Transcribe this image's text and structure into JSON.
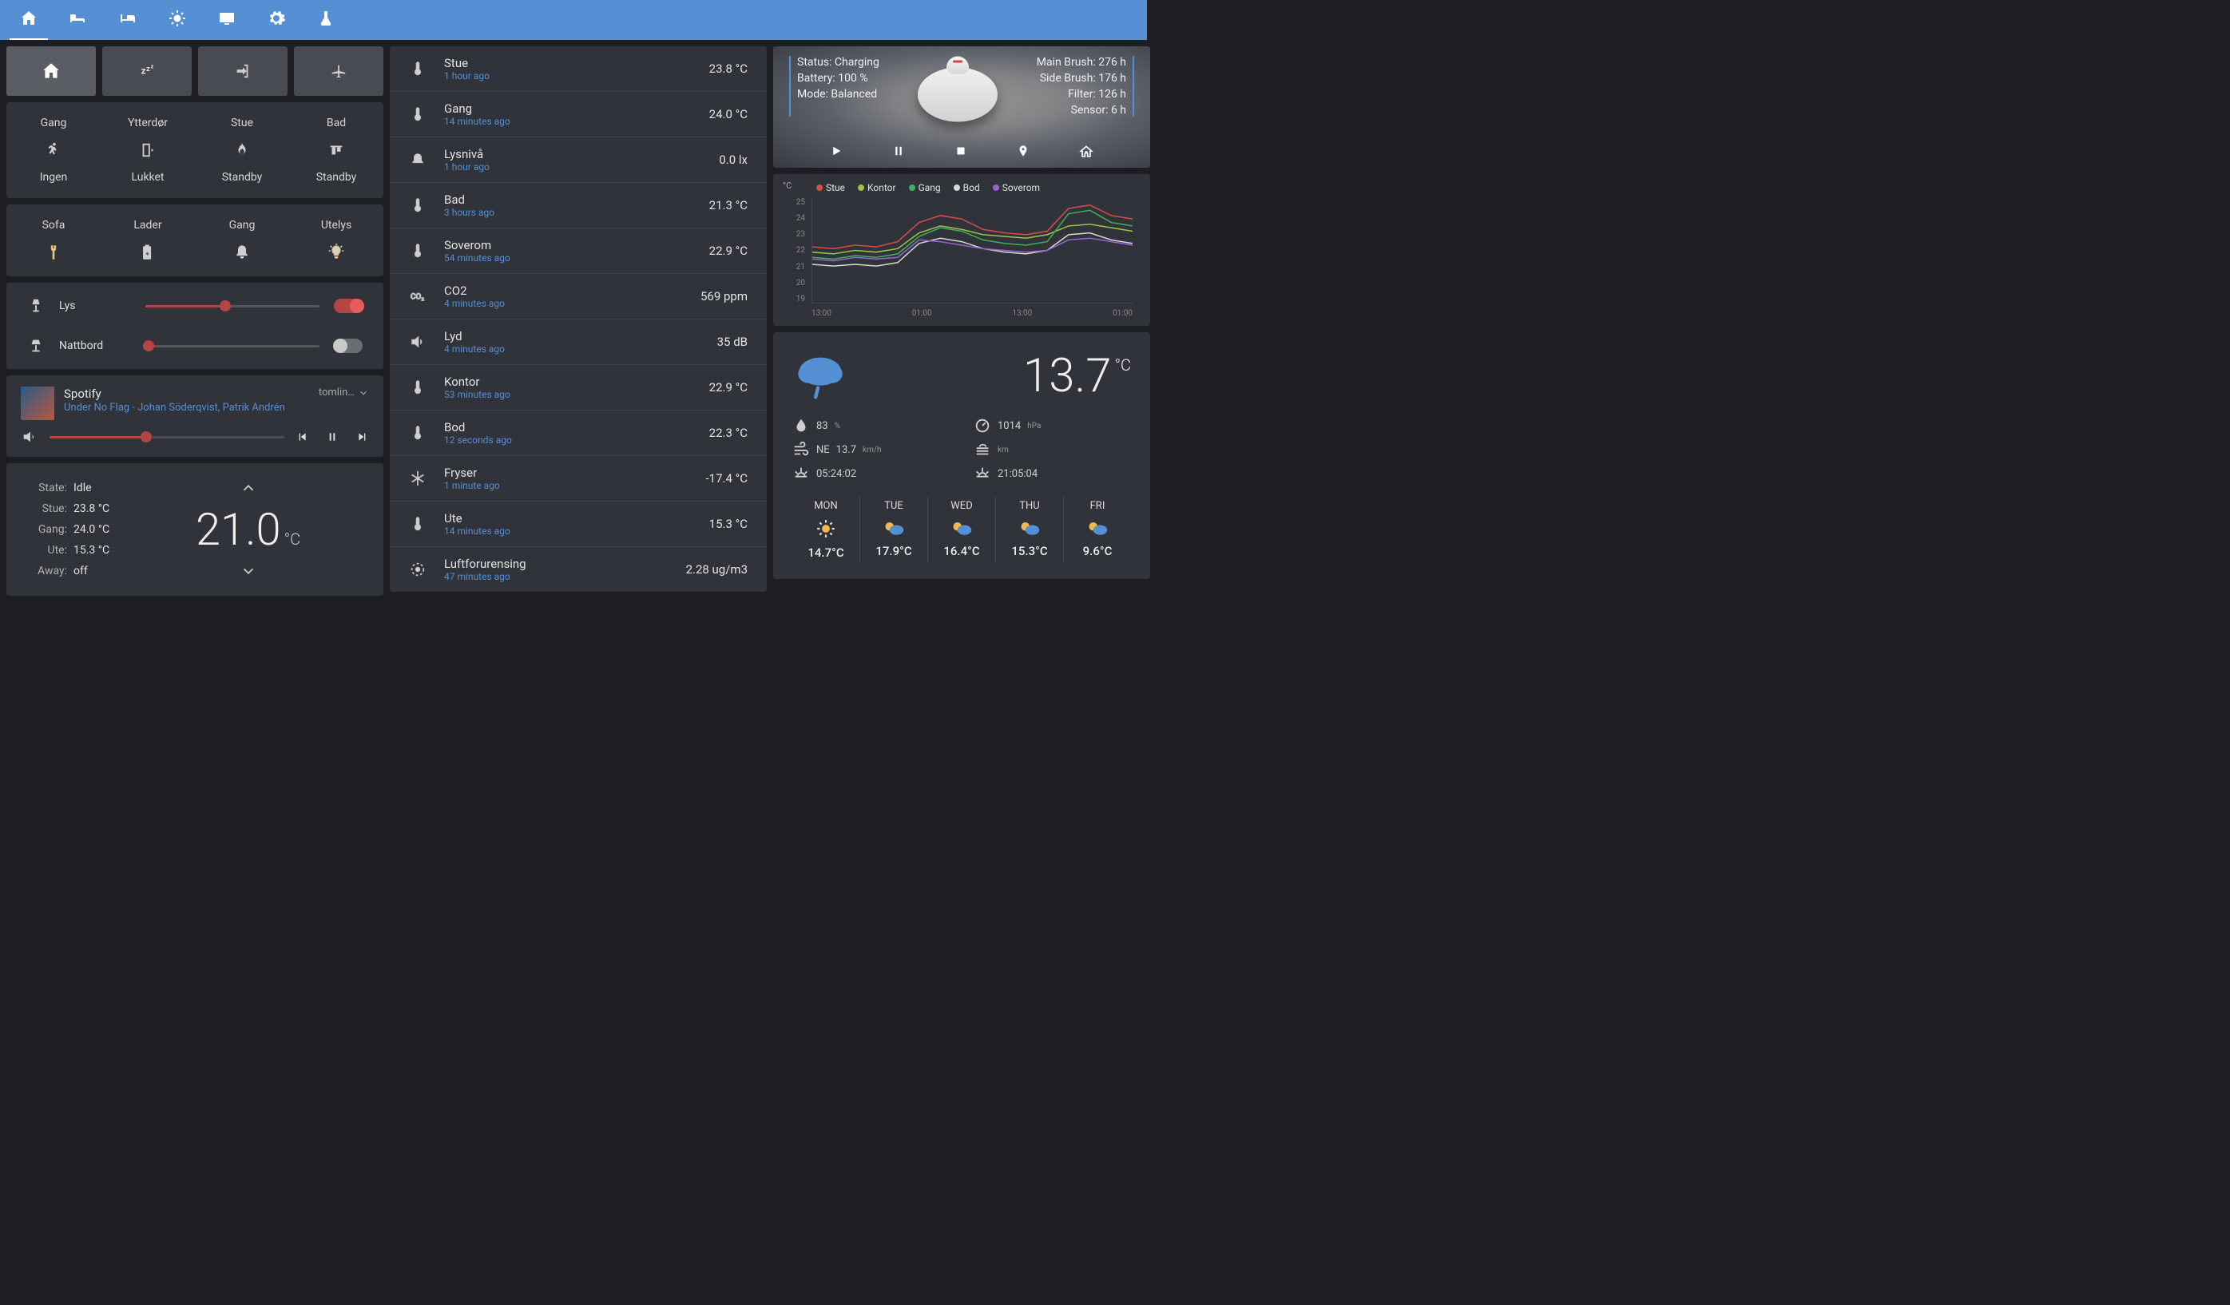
{
  "tabs": [
    {
      "icon": "home"
    },
    {
      "icon": "bed2"
    },
    {
      "icon": "bed"
    },
    {
      "icon": "sun"
    },
    {
      "icon": "tv"
    },
    {
      "icon": "gear"
    },
    {
      "icon": "tube"
    }
  ],
  "scenes": [
    {
      "icon": "home",
      "active": true
    },
    {
      "icon": "zzz"
    },
    {
      "icon": "exit"
    },
    {
      "icon": "plane"
    }
  ],
  "rooms": [
    {
      "name": "Gang",
      "state": "Ingen",
      "icon": "motion"
    },
    {
      "name": "Ytterdør",
      "state": "Lukket",
      "icon": "door"
    },
    {
      "name": "Stue",
      "state": "Standby",
      "icon": "flame"
    },
    {
      "name": "Bad",
      "state": "Standby",
      "icon": "towel"
    }
  ],
  "switches": [
    {
      "name": "Sofa",
      "icon": "plug",
      "on": true
    },
    {
      "name": "Lader",
      "icon": "battery",
      "on": false
    },
    {
      "name": "Gang",
      "icon": "bell",
      "on": false
    },
    {
      "name": "Utelys",
      "icon": "bulb",
      "on": true
    }
  ],
  "sliders": {
    "lys": {
      "label": "Lys",
      "value": 46,
      "on": true,
      "icon": "lamp"
    },
    "nattbord": {
      "label": "Nattbord",
      "value": 0,
      "on": false,
      "icon": "lamp2"
    }
  },
  "media": {
    "source": "Spotify",
    "track": "Under No Flag - Johan Söderqvist, Patrik Andrén",
    "sink": "tomlin…",
    "volume": 41
  },
  "climate": {
    "state_label": "State:",
    "state": "Idle",
    "stue_label": "Stue:",
    "stue": "23.8 °C",
    "gang_label": "Gang:",
    "gang": "24.0 °C",
    "ute_label": "Ute:",
    "ute": "15.3 °C",
    "away_label": "Away:",
    "away": "off",
    "setpoint": "21.0",
    "unit": "°C"
  },
  "sensors": [
    {
      "icon": "thermo",
      "name": "Stue",
      "time": "1 hour ago",
      "value": "23.8 °C"
    },
    {
      "icon": "thermo",
      "name": "Gang",
      "time": "14 minutes ago",
      "value": "24.0 °C"
    },
    {
      "icon": "bell2",
      "name": "Lysnivå",
      "time": "1 hour ago",
      "value": "0.0 lx"
    },
    {
      "icon": "thermo",
      "name": "Bad",
      "time": "3 hours ago",
      "value": "21.3 °C"
    },
    {
      "icon": "thermo",
      "name": "Soverom",
      "time": "54 minutes ago",
      "value": "22.9 °C"
    },
    {
      "icon": "co2",
      "name": "CO2",
      "time": "4 minutes ago",
      "value": "569 ppm"
    },
    {
      "icon": "speaker",
      "name": "Lyd",
      "time": "4 minutes ago",
      "value": "35 dB"
    },
    {
      "icon": "thermo",
      "name": "Kontor",
      "time": "53 minutes ago",
      "value": "22.9 °C"
    },
    {
      "icon": "thermo",
      "name": "Bod",
      "time": "12 seconds ago",
      "value": "22.3 °C"
    },
    {
      "icon": "snow",
      "name": "Fryser",
      "time": "1 minute ago",
      "value": "-17.4 °C"
    },
    {
      "icon": "thermo",
      "name": "Ute",
      "time": "14 minutes ago",
      "value": "15.3 °C"
    },
    {
      "icon": "target",
      "name": "Luftforurensing",
      "time": "47 minutes ago",
      "value": "2.28 ug/m3"
    }
  ],
  "vacuum": {
    "status_label": "Status:",
    "status": "Charging",
    "battery_label": "Battery:",
    "battery": "100 %",
    "mode_label": "Mode:",
    "mode": "Balanced",
    "mainbrush": "Main Brush: 276 h",
    "sidebrush": "Side Brush: 176 h",
    "filter": "Filter: 126 h",
    "sensor": "Sensor: 6 h"
  },
  "chart_data": {
    "type": "line",
    "ylabel": "°C",
    "ylim": [
      19,
      25
    ],
    "yticks": [
      25,
      24,
      23,
      22,
      21,
      20,
      19
    ],
    "x_labels": [
      "13:00",
      "01:00",
      "13:00",
      "01:00"
    ],
    "series": [
      {
        "name": "Stue",
        "color": "#d84c4c",
        "values": [
          22.2,
          22.1,
          22.3,
          22.2,
          22.5,
          23.6,
          24.0,
          23.8,
          23.2,
          23.0,
          22.9,
          23.1,
          24.4,
          24.6,
          24.0,
          23.8
        ]
      },
      {
        "name": "Kontor",
        "color": "#9fc24a",
        "values": [
          21.9,
          21.8,
          22.0,
          21.9,
          22.1,
          23.0,
          23.4,
          23.2,
          22.9,
          22.8,
          22.7,
          22.9,
          23.4,
          23.5,
          23.3,
          23.1
        ]
      },
      {
        "name": "Gang",
        "color": "#3cb15a",
        "values": [
          21.6,
          21.5,
          21.7,
          21.6,
          21.8,
          22.8,
          23.3,
          23.1,
          22.6,
          22.4,
          22.3,
          22.5,
          24.1,
          24.3,
          23.6,
          23.4
        ]
      },
      {
        "name": "Bod",
        "color": "#d8d8d8",
        "values": [
          21.2,
          21.1,
          21.2,
          21.1,
          21.3,
          22.4,
          22.7,
          22.5,
          22.1,
          21.9,
          21.8,
          22.0,
          22.9,
          23.0,
          22.6,
          22.4
        ]
      },
      {
        "name": "Soverom",
        "color": "#9a62d2",
        "values": [
          21.5,
          21.4,
          21.6,
          21.5,
          21.6,
          22.6,
          22.5,
          22.3,
          22.1,
          22.0,
          21.9,
          22.0,
          22.6,
          22.7,
          22.5,
          22.3
        ]
      }
    ]
  },
  "weather": {
    "temp": "13.7",
    "temp_unit": "°C",
    "humidity": "83",
    "humidity_unit": "%",
    "pressure": "1014",
    "pressure_unit": "hPa",
    "wind_dir": "NE",
    "wind": "13.7",
    "wind_unit": "km/h",
    "vis_unit": "km",
    "sunrise": "05:24:02",
    "sunset": "21:05:04",
    "forecast": [
      {
        "day": "MON",
        "icon": "sunny",
        "temp": "14.7°C"
      },
      {
        "day": "TUE",
        "icon": "partly",
        "temp": "17.9°C"
      },
      {
        "day": "WED",
        "icon": "partly",
        "temp": "16.4°C"
      },
      {
        "day": "THU",
        "icon": "partly",
        "temp": "15.3°C"
      },
      {
        "day": "FRI",
        "icon": "partly",
        "temp": "9.6°C"
      }
    ]
  },
  "colors": {
    "accent": "#5590d4",
    "danger": "#d84c4c",
    "on": "#f2b84b"
  }
}
